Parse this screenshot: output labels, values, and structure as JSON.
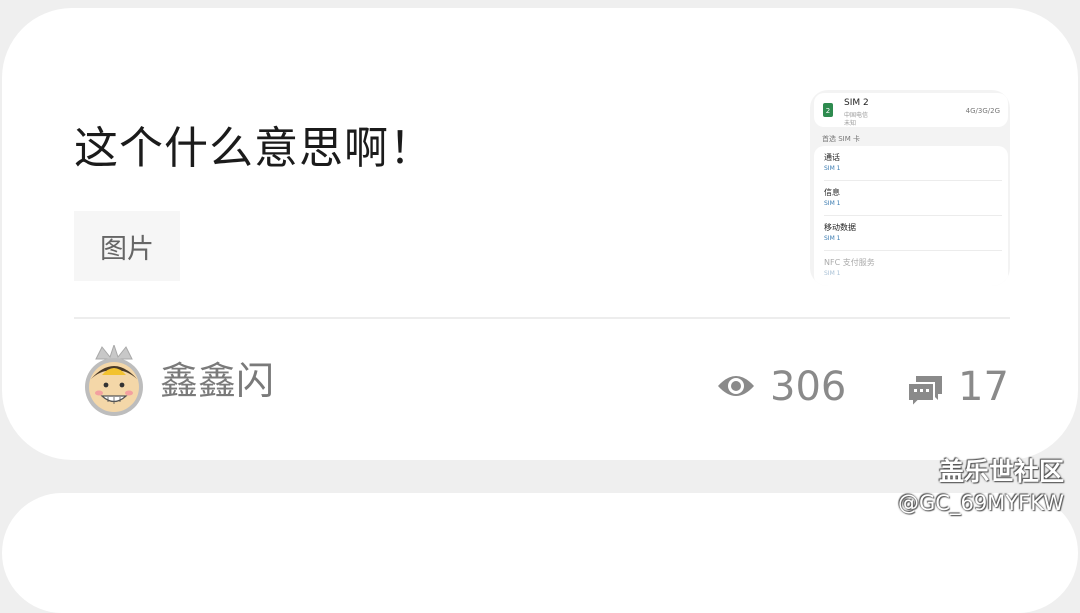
{
  "post": {
    "title": "这个什么意思啊！",
    "tag": "图片",
    "thumbnail": {
      "sim_name": "SIM 2",
      "sim_badge": "2",
      "carrier": "中国电信",
      "status": "未知",
      "network": "4G/3G/2G",
      "preferred_label": "首选 SIM 卡",
      "rows": [
        {
          "title": "通话",
          "sub": "SIM 1"
        },
        {
          "title": "信息",
          "sub": "SIM 1"
        },
        {
          "title": "移动数据",
          "sub": "SIM 1"
        },
        {
          "title": "NFC 支付服务",
          "sub": "SIM 1"
        }
      ]
    },
    "author": "鑫鑫闪",
    "views": "306",
    "comments": "17"
  },
  "watermark": {
    "name": "盖乐世社区",
    "handle": "@GC_69MYFKW"
  },
  "colors": {
    "background": "#efefef",
    "card": "#ffffff",
    "meta_text": "#8a8a8a"
  },
  "icons": [
    "eye-icon",
    "comments-icon",
    "avatar"
  ]
}
